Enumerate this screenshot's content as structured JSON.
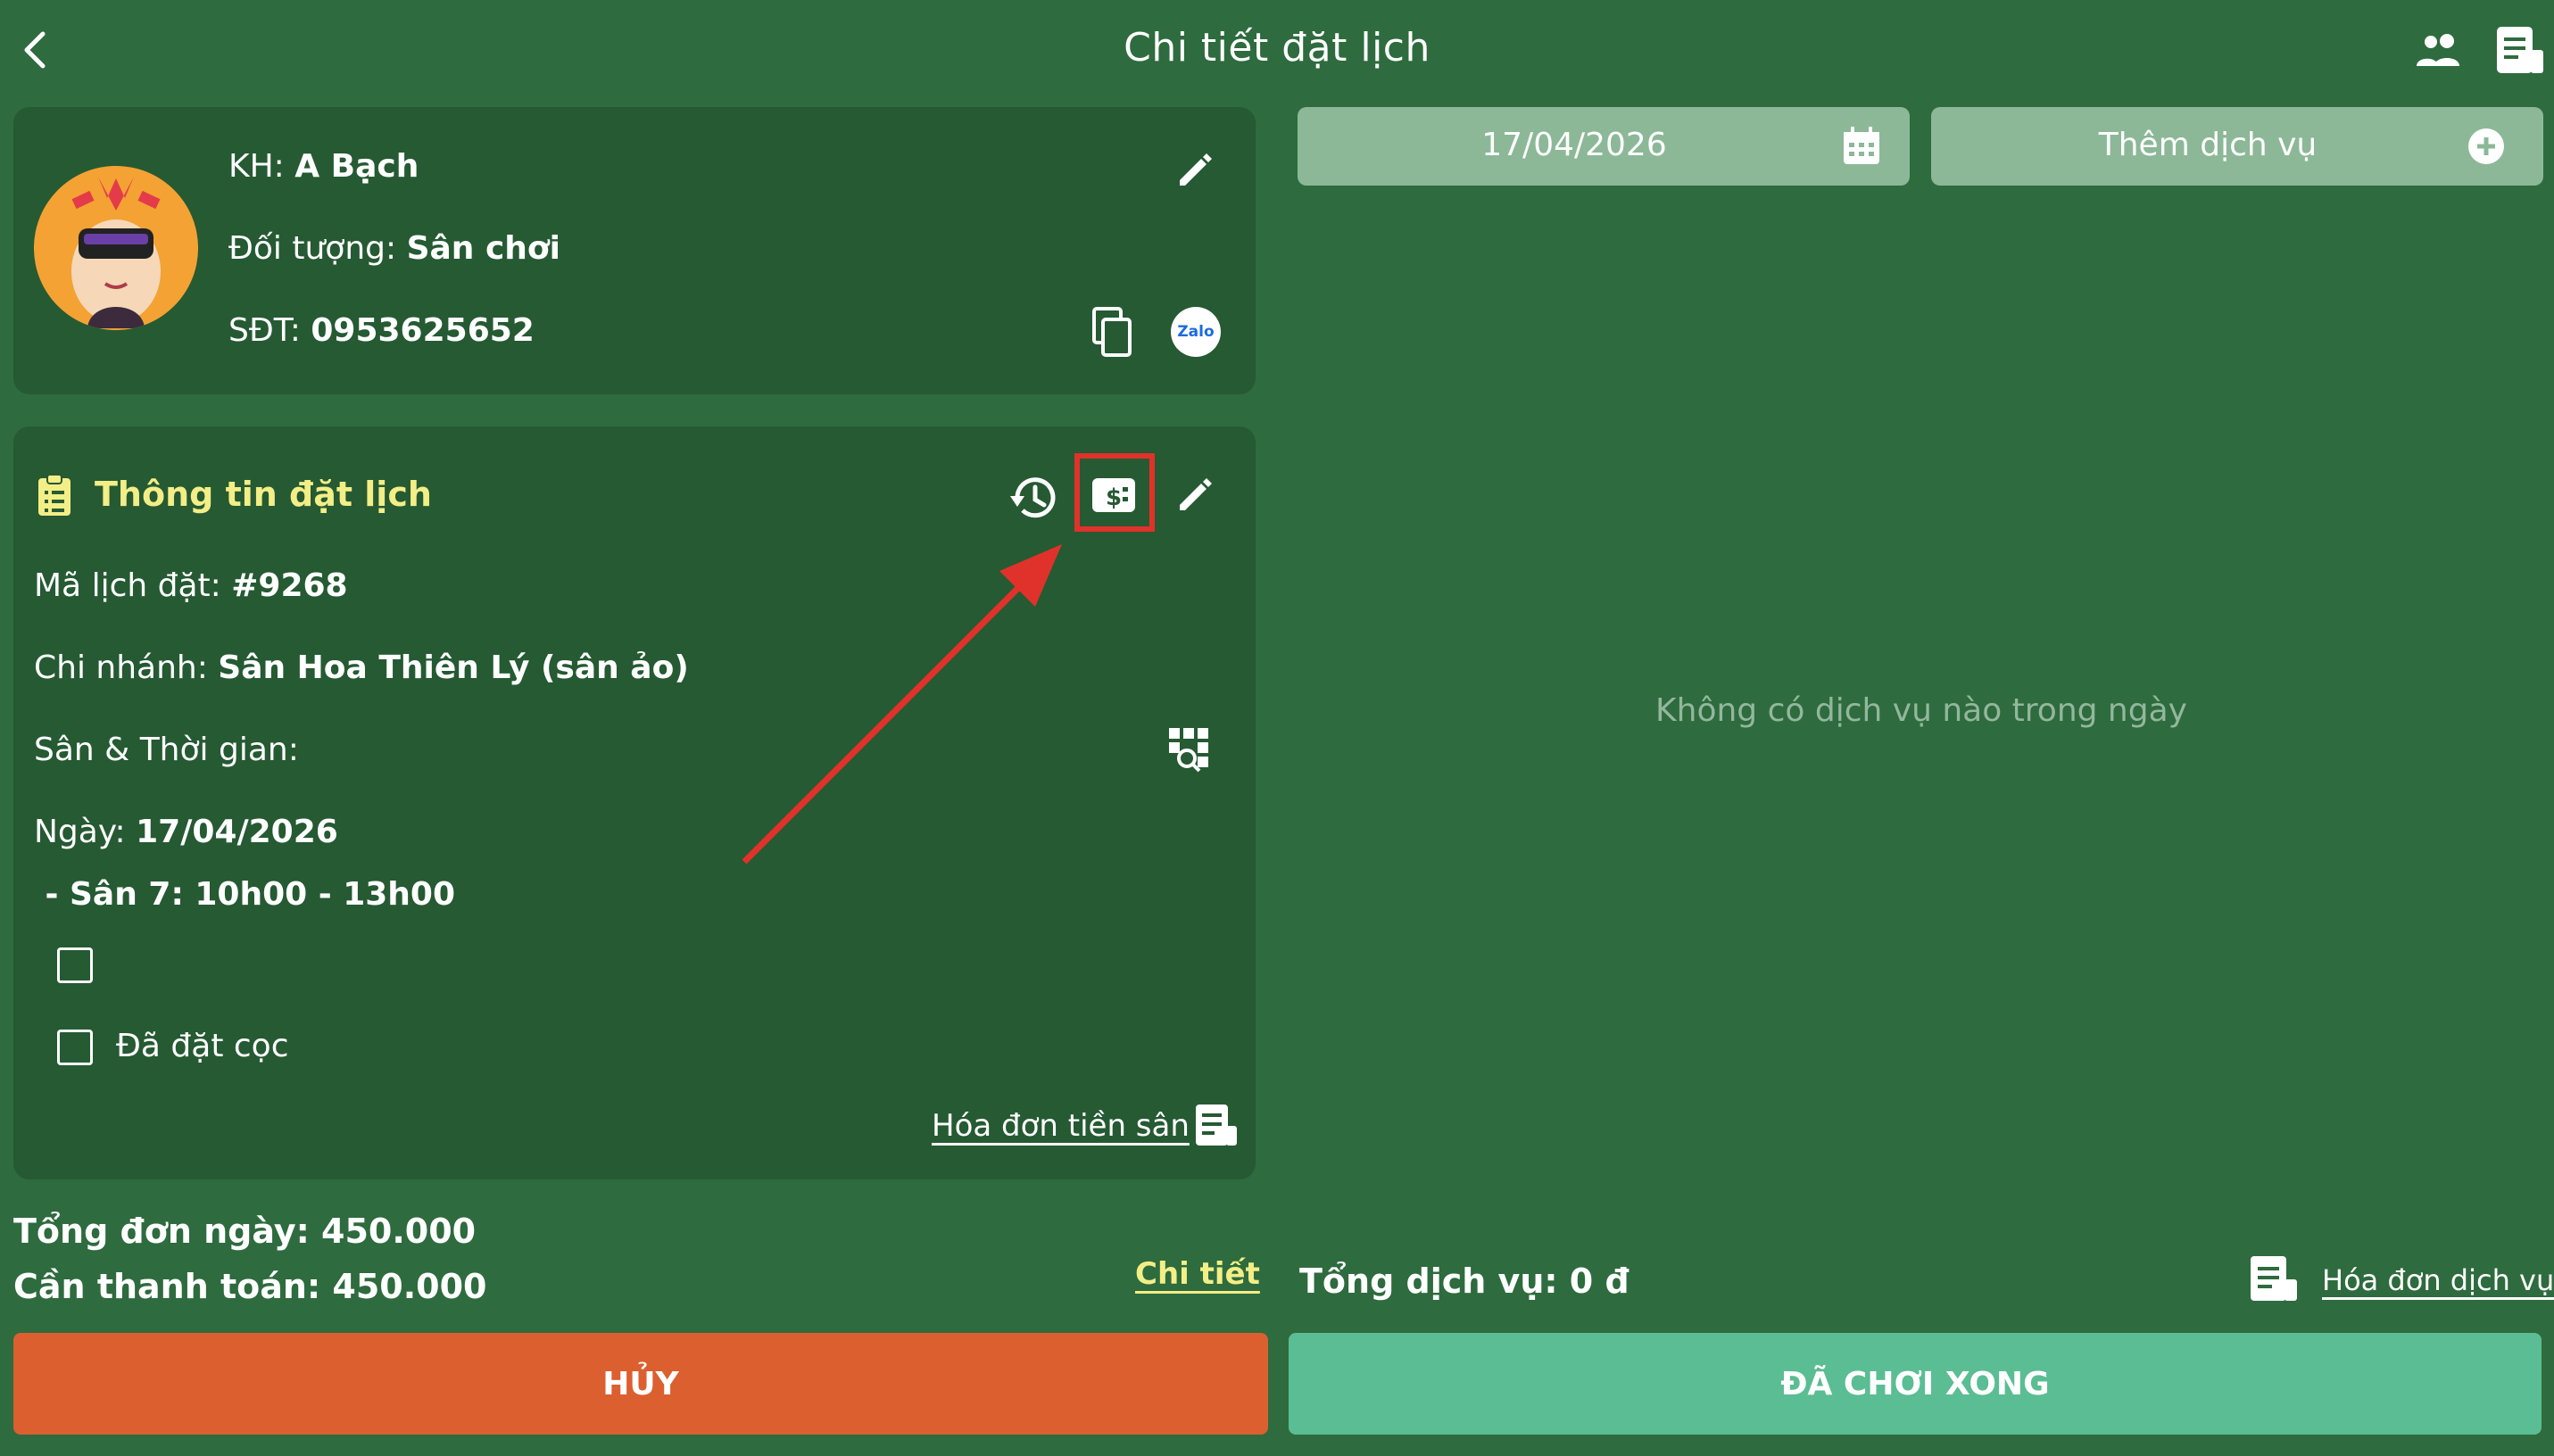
{
  "header": {
    "title": "Chi tiết đặt lịch",
    "back_icon": "chevron-left-icon",
    "right_icons": [
      "people-icon",
      "receipt-icon"
    ]
  },
  "customer": {
    "name_label": "KH: ",
    "name": "A Bạch",
    "target_label": "Đối tượng: ",
    "target": "Sân chơi",
    "phone_label": "SĐT: ",
    "phone": "0953625652",
    "zalo_label": "Zalo"
  },
  "booking": {
    "section_title": "Thông tin đặt lịch",
    "code_label": "Mã lịch đặt: ",
    "code": "#9268",
    "branch_label": "Chi nhánh: ",
    "branch": "Sân Hoa Thiên Lý (sân ảo)",
    "court_time_label": "Sân & Thời gian:",
    "date_label": "Ngày: ",
    "date": "17/04/2026",
    "slot": " - Sân 7: 10h00 - 13h00",
    "deposit_label": "Đã đặt cọc",
    "invoice_link": "Hóa đơn tiền sân"
  },
  "totals": {
    "day_total_label": "Tổng đơn ngày: ",
    "day_total": "450.000",
    "to_pay_label": "Cần thanh toán: ",
    "to_pay": "450.000",
    "detail_link": "Chi tiết"
  },
  "services": {
    "date_value": "17/04/2026",
    "add_service_label": "Thêm dịch vụ",
    "empty_message": "Không có dịch vụ nào trong ngày",
    "total_label": "Tổng dịch vụ: ",
    "total_value": "0 đ",
    "invoice_link": "Hóa đơn dịch vụ"
  },
  "actions": {
    "cancel_label": "HỦY",
    "done_label": "ĐÃ CHƠI XONG"
  },
  "colors": {
    "background": "#2e6b3e",
    "card": "#255a33",
    "accent_yellow": "#f3ee86",
    "cancel": "#dc5f2f",
    "done": "#5bbd93",
    "highlight": "#e0322a"
  }
}
